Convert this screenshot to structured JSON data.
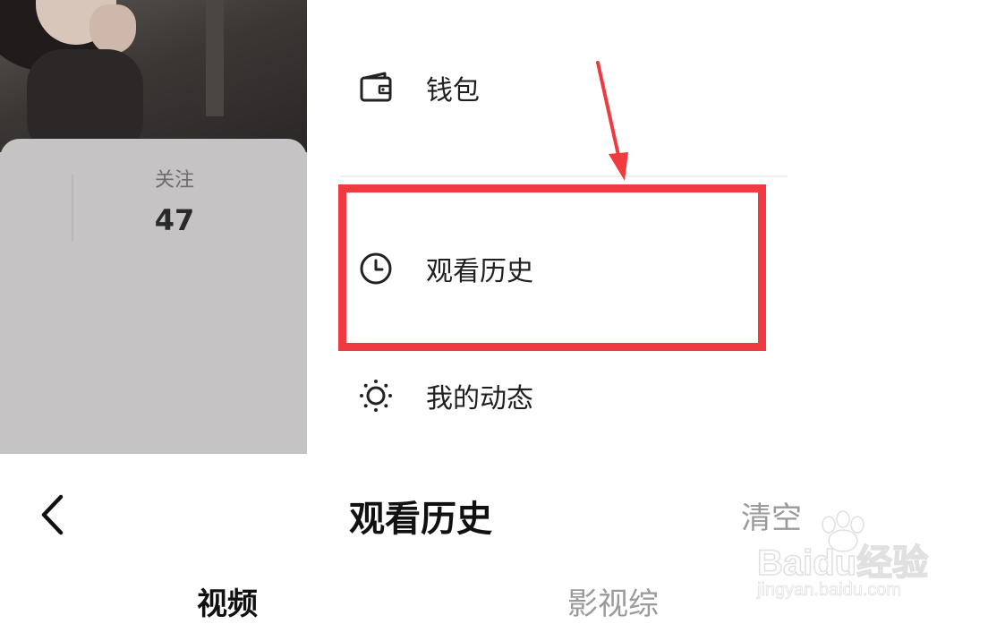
{
  "profile": {
    "follow_label": "关注",
    "follow_count": "47"
  },
  "menu": {
    "items": [
      {
        "label": "钱包",
        "icon": "wallet-icon"
      },
      {
        "label": "观看历史",
        "icon": "clock-icon"
      },
      {
        "label": "我的动态",
        "icon": "sun-icon"
      }
    ]
  },
  "annotation": {
    "highlight_color": "#f03a3f"
  },
  "history_page": {
    "back_icon": "chevron-left-icon",
    "title": "观看历史",
    "clear_label": "清空",
    "tabs": [
      {
        "label": "视频",
        "active": true
      },
      {
        "label": "影视综",
        "active": false
      }
    ]
  },
  "watermark": {
    "brand": "Baidu经验",
    "url": "jingyan.baidu.com"
  }
}
